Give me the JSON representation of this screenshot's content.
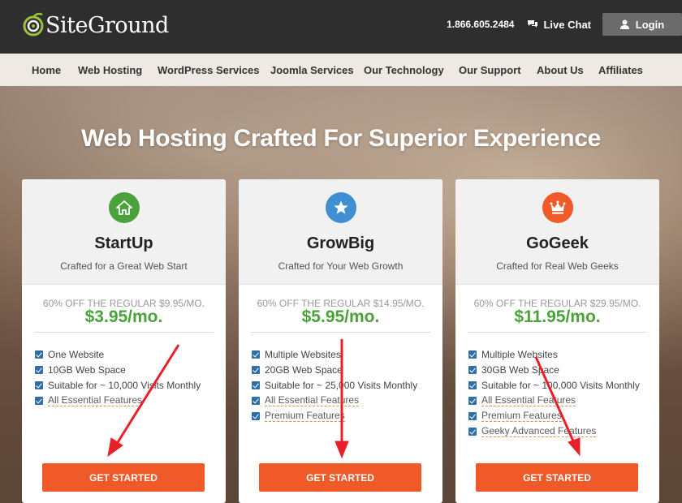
{
  "header": {
    "logo_text": "SiteGround",
    "phone": "1.866.605.2484",
    "live_chat": "Live Chat",
    "login": "Login"
  },
  "nav": {
    "items": [
      "Home",
      "Web Hosting",
      "WordPress Services",
      "Joomla Services",
      "Our Technology",
      "Our Support",
      "About Us",
      "Affiliates"
    ]
  },
  "hero": {
    "title": "Web Hosting Crafted For Superior Experience"
  },
  "plans": [
    {
      "name": "StartUp",
      "tagline": "Crafted for a Great Web Start",
      "regular": "60% OFF THE REGULAR $9.95/MO.",
      "price": "$3.95/mo.",
      "icon": "house-icon",
      "icon_color": "#4aa23a",
      "features": [
        "One Website",
        "10GB Web Space",
        "Suitable for ~ 10,000 Visits Monthly",
        "All Essential Features"
      ],
      "cta": "GET STARTED"
    },
    {
      "name": "GrowBig",
      "tagline": "Crafted for Your Web Growth",
      "regular": "60% OFF THE REGULAR $14.95/MO.",
      "price": "$5.95/mo.",
      "icon": "star-icon",
      "icon_color": "#3f8fd2",
      "features": [
        "Multiple Websites",
        "20GB Web Space",
        "Suitable for ~ 25,000 Visits Monthly",
        "All Essential Features",
        "Premium Features"
      ],
      "cta": "GET STARTED"
    },
    {
      "name": "GoGeek",
      "tagline": "Crafted for Real Web Geeks",
      "regular": "60% OFF THE REGULAR $29.95/MO.",
      "price": "$11.95/mo.",
      "icon": "crown-icon",
      "icon_color": "#f05a28",
      "features": [
        "Multiple Websites",
        "30GB Web Space",
        "Suitable for ~ 100,000 Visits Monthly",
        "All Essential Features",
        "Premium Features",
        "Geeky Advanced Features"
      ],
      "cta": "GET STARTED"
    }
  ],
  "colors": {
    "cta": "#f05a28",
    "price": "#4aa23a",
    "annotation_arrow": "#e8202a"
  }
}
